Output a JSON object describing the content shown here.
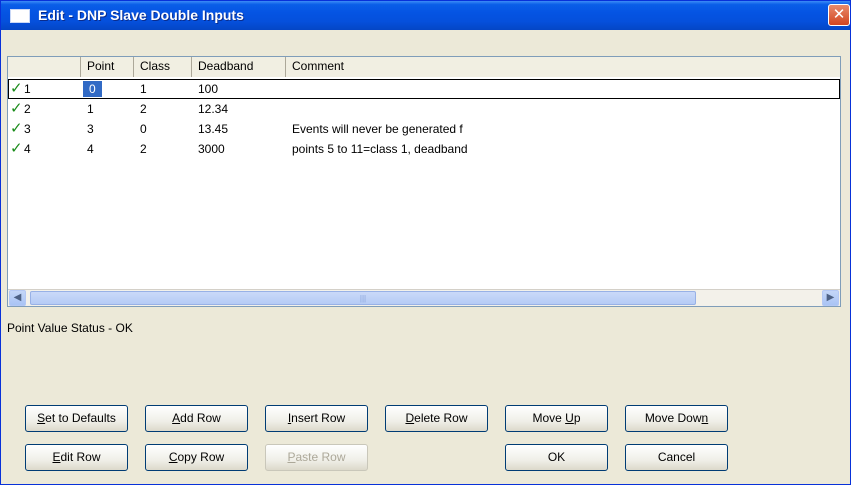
{
  "window": {
    "title": "Edit - DNP Slave Double Inputs",
    "close_glyph": "✕"
  },
  "grid": {
    "columns": [
      "Point",
      "Class",
      "Deadband",
      "Comment"
    ],
    "rows": [
      {
        "num": "1",
        "point": "0",
        "class": "1",
        "deadband": "100",
        "comment": ""
      },
      {
        "num": "2",
        "point": "1",
        "class": "2",
        "deadband": "12.34",
        "comment": ""
      },
      {
        "num": "3",
        "point": "3",
        "class": "0",
        "deadband": "13.45",
        "comment": "Events will never be generated f"
      },
      {
        "num": "4",
        "point": "4",
        "class": "2",
        "deadband": "3000",
        "comment": "points 5 to 11=class 1, deadband"
      }
    ],
    "check_glyph": "✓",
    "scroll_left": "◀",
    "scroll_right": "▶",
    "scroll_grip": "|||"
  },
  "status": "Point Value Status - OK",
  "buttons": {
    "set_defaults": {
      "pre": "",
      "key": "S",
      "post": "et to Defaults"
    },
    "add_row": {
      "pre": "",
      "key": "A",
      "post": "dd Row"
    },
    "insert_row": {
      "pre": "",
      "key": "I",
      "post": "nsert Row"
    },
    "delete_row": {
      "pre": "",
      "key": "D",
      "post": "elete Row"
    },
    "move_up": {
      "pre": "Move ",
      "key": "U",
      "post": "p"
    },
    "move_down": {
      "pre": "Move Dow",
      "key": "n",
      "post": ""
    },
    "edit_row": {
      "pre": "",
      "key": "E",
      "post": "dit Row"
    },
    "copy_row": {
      "pre": "",
      "key": "C",
      "post": "opy Row"
    },
    "paste_row": {
      "pre": "",
      "key": "P",
      "post": "aste Row"
    },
    "ok": "OK",
    "cancel": "Cancel"
  }
}
